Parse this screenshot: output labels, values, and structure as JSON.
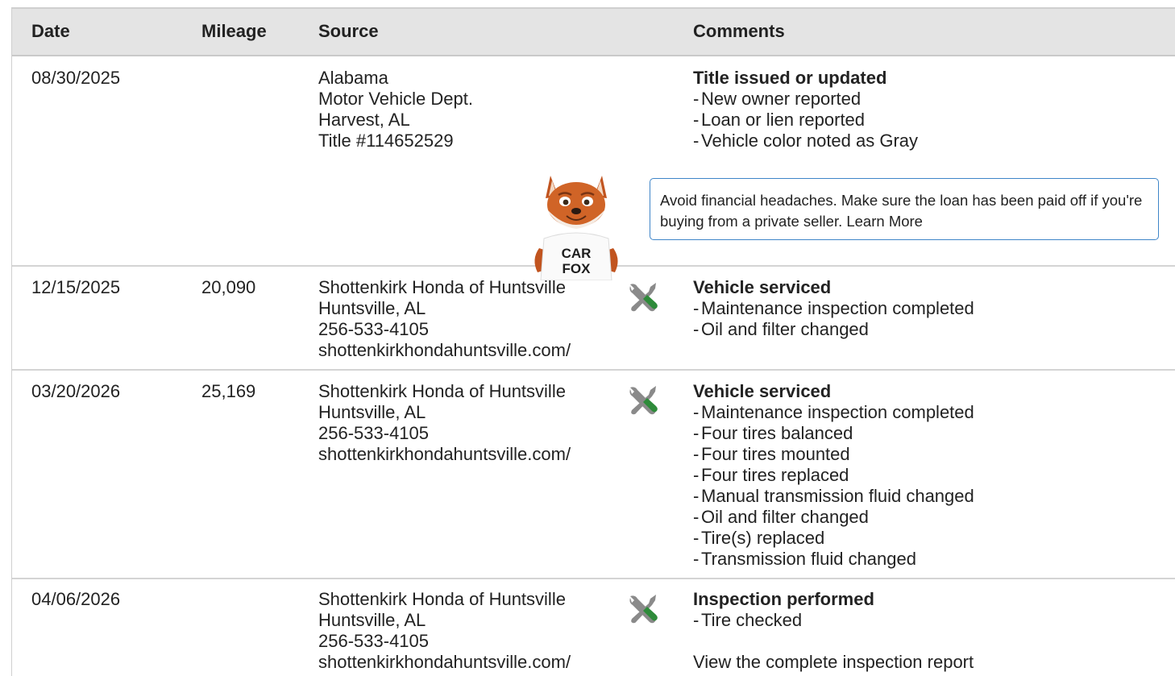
{
  "headers": {
    "date": "Date",
    "mileage": "Mileage",
    "source": "Source",
    "comments": "Comments"
  },
  "rows": [
    {
      "date": "08/30/2025",
      "mileage": "",
      "source": [
        "Alabama",
        "Motor Vehicle Dept.",
        "Harvest, AL",
        "Title #114652529"
      ],
      "service_icon": false,
      "title": "Title issued or updated",
      "details": [
        "New owner reported",
        "Loan or lien reported",
        "Vehicle color noted as Gray"
      ]
    },
    {
      "date": "12/15/2025",
      "mileage": "20,090",
      "source": [
        "Shottenkirk Honda of Huntsville",
        "Huntsville, AL",
        "256-533-4105",
        "shottenkirkhondahuntsville.com/"
      ],
      "service_icon": true,
      "title": "Vehicle serviced",
      "details": [
        "Maintenance inspection completed",
        "Oil and filter changed"
      ]
    },
    {
      "date": "03/20/2026",
      "mileage": "25,169",
      "source": [
        "Shottenkirk Honda of Huntsville",
        "Huntsville, AL",
        "256-533-4105",
        "shottenkirkhondahuntsville.com/"
      ],
      "service_icon": true,
      "title": "Vehicle serviced",
      "details": [
        "Maintenance inspection completed",
        "Four tires balanced",
        "Four tires mounted",
        "Four tires replaced",
        "Manual transmission fluid changed",
        "Oil and filter changed",
        "Tire(s) replaced",
        "Transmission fluid changed"
      ]
    },
    {
      "date": "04/06/2026",
      "mileage": "",
      "source": [
        "Shottenkirk Honda of Huntsville",
        "Huntsville, AL",
        "256-533-4105",
        "shottenkirkhondahuntsville.com/"
      ],
      "service_icon": true,
      "title": "Inspection performed",
      "details": [
        "Tire checked"
      ],
      "link": "View the complete inspection report"
    }
  ],
  "tip": {
    "text": "Avoid financial headaches. Make sure the loan has been paid off if you're buying from a private seller.",
    "link": "Learn More"
  },
  "mascot": {
    "shirt_line1": "CAR",
    "shirt_line2": "FOX",
    "icon": "carfox-mascot"
  },
  "icons": {
    "service": "wrench-screwdriver-icon"
  },
  "colors": {
    "header_bg": "#e4e4e4",
    "tip_border": "#3f85c8",
    "wrench_gray": "#8a8a8a",
    "screwdriver_green": "#2e8b3a"
  }
}
